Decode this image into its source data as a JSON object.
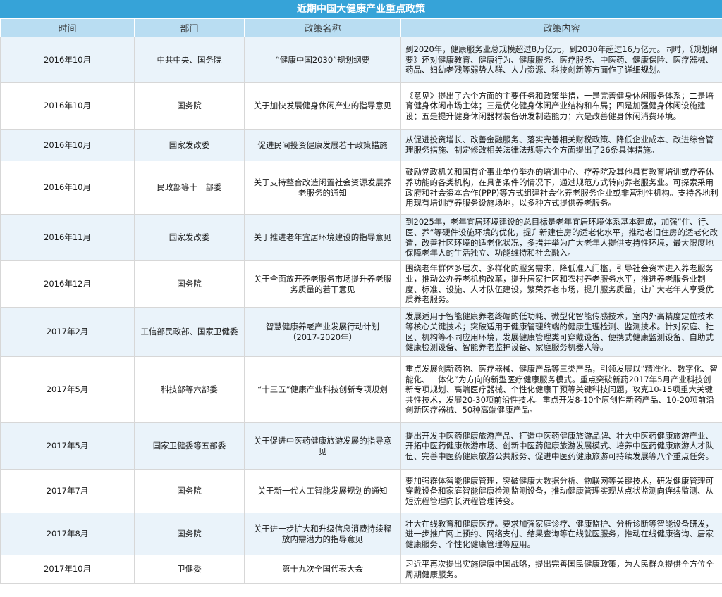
{
  "title": "近期中国大健康产业重点政策",
  "headers": {
    "time": "时间",
    "dept": "部门",
    "name": "政策名称",
    "content": "政策内容"
  },
  "rows": [
    {
      "time": "2016年10月",
      "dept": "中共中央、国务院",
      "name": "“健康中国2030”规划纲要",
      "content": "到2020年，健康服务业总规模超过8万亿元，到2030年超过16万亿元。同时，《规划纲要》还对健康教育、健康行为、健康服务、医疗服务、中医药、健康保险、医疗器械、药品、妇幼老残等弱势人群、人力资源、科技创新等方面作了详细规划。"
    },
    {
      "time": "2016年10月",
      "dept": "国务院",
      "name": "关于加快发展健身休闲产业的指导意见",
      "content": "《意见》提出了六个方面的主要任务和政策举措，一是完善健身休闲服务体系；二是培育健身休闲市场主体；三是优化健身休闲产业结构和布局；四是加强健身休闲设施建设；五是提升健身休闲器材装备研发制造能力；六是改善健身休闲消费环境。"
    },
    {
      "time": "2016年10月",
      "dept": "国家发改委",
      "name": "促进民间投资健康发展若干政策措施",
      "content": "从促进投资增长、改善金融服务、落实完善相关财税政策、降低企业成本、改进综合管理服务措施、制定修改相关法律法规等六个方面提出了26条具体措施。"
    },
    {
      "time": "2016年10月",
      "dept": "民政部等十一部委",
      "name": "关于支持整合改造闲置社会资源发展养老服务的通知",
      "content": "鼓励党政机关和国有企事业单位举办的培训中心、疗养院及其他具有教育培训或疗养休养功能的各类机构，在具备条件的情况下，通过规范方式转向养老服务业。可探索采用政府和社会资本合作(PPP)等方式组建社会化养老服务企业或非营利性机构。支持各地利用现有培训疗养服务设施场地，以多种方式提供养老服务。"
    },
    {
      "time": "2016年11月",
      "dept": "国家发改委",
      "name": "关于推进老年宜居环境建设的指导意见",
      "content": "到2025年，老年宜居环境建设的总目标是老年宜居环境体系基本建成，加强“住、行、医、养”等硬件设施环境的优化，提升新建住房的适老化水平，推动老旧住房的适老化改造，改善社区环境的适老化状况，多措并举为广大老年人提供支持性环境，最大限度地保障老年人的生活独立、功能维持和社会融入。"
    },
    {
      "time": "2016年12月",
      "dept": "国务院",
      "name": "关于全面放开养老服务市场提升养老服务质量的若干意见",
      "content": "围绕老年群体多层次、多样化的服务需求，降低准入门槛，引导社会资本进入养老服务业，推动公办养老机构改革，提升居家社区和农村养老服务水平，推进养老服务业制度、标准、设施、人才队伍建设，繁荣养老市场，提升服务质量，让广大老年人享受优质养老服务。"
    },
    {
      "time": "2017年2月",
      "dept": "工信部民政部、国家卫健委",
      "name": "智慧健康养老产业发展行动计划（2017-2020年）",
      "content": "发展适用于智能健康养老终端的低功耗、微型化智能传感技术，室内外高精度定位技术等核心关键技术；突破适用于健康管理终端的健康生理检测、监测技术。针对家庭、社区、机构等不同应用环境，发展健康管理类可穿戴设备、便携式健康监测设备、自助式健康检测设备、智能养老监护设备、家庭服务机器人等。"
    },
    {
      "time": "2017年5月",
      "dept": "科技部等六部委",
      "name": "“十三五”健康产业科技创新专项规划",
      "content": "重点发展创新药物、医疗器械、健康产品等三类产品，引领发展以“精准化、数字化、智能化、一体化”为方向的新型医疗健康服务模式。重点突破新药2017年5月产业科技创新专项规划、高端医疗器械、个性化健康干预等关键科技问题，攻克10-15项重大关键共性技术，发展20-30项前沿性技术。重点开发8-10个原创性新药产品、10-20项前沿创新医疗器械、50种高端健康产品。"
    },
    {
      "time": "2017年5月",
      "dept": "国家卫健委等五部委",
      "name": "关于促进中医药健康旅游发展的指导意见",
      "content": "提出开发中医药健康旅游产品、打造中医药健康旅游品牌、壮大中医药健康旅游产业、开拓中医药健康旅游市场、创新中医药健康旅游发展模式、培养中医药健康旅游人才队伍、完善中医药健康旅游公共服务、促进中医药健康旅游可持续发展等八个重点任务。"
    },
    {
      "time": "2017年7月",
      "dept": "国务院",
      "name": "关于新一代人工智能发展规划的通知",
      "content": "要加强群体智能健康管理，突破健康大数据分析、物联网等关键技术，研发健康管理可穿戴设备和家庭智能健康检测监测设备，推动健康管理实现从点状监测向连续监测、从短流程管理向长流程管理转变。"
    },
    {
      "time": "2017年8月",
      "dept": "国务院",
      "name": "关于进一步扩大和升级信息消费持续释放内需潜力的指导意见",
      "content": "壮大在线教育和健康医疗。要求加强家庭诊疗、健康监护、分析诊断等智能设备研发，进一步推广网上预约、网络支付、结果查询等在线就医服务，推动在线健康咨询、居家健康服务、个性化健康管理等应用。"
    },
    {
      "time": "2017年10月",
      "dept": "卫健委",
      "name": "第十九次全国代表大会",
      "content": "习近平再次提出实施健康中国战略，提出完善国民健康政策，为人民群众提供全方位全周期健康服务。"
    }
  ]
}
